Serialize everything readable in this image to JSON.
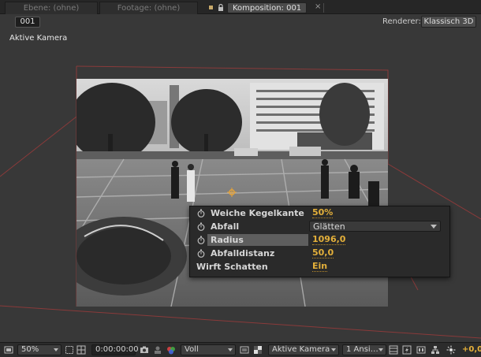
{
  "tabs": {
    "layer": "Ebene: (ohne)",
    "footage": "Footage: (ohne)",
    "composition": "Komposition: 001",
    "close": "×"
  },
  "toolbar": {
    "frame_label": "001",
    "renderer_label": "Renderer:",
    "renderer_value": "Klassisch 3D"
  },
  "viewport": {
    "camera_label": "Aktive Kamera"
  },
  "properties": [
    {
      "name": "Weiche Kegelkante",
      "value": "50%",
      "stopwatch": true
    },
    {
      "name": "Abfall",
      "value": "Glätten",
      "stopwatch": true,
      "dropdown": true
    },
    {
      "name": "Radius",
      "value": "1096,0",
      "stopwatch": true,
      "highlighted": true
    },
    {
      "name": "Abfalldistanz",
      "value": "50,0",
      "stopwatch": true
    },
    {
      "name": "Wirft Schatten",
      "value": "Ein",
      "stopwatch": false
    }
  ],
  "bottombar": {
    "zoom": "50%",
    "timecode": "0:00:00:00",
    "resolution": "Voll",
    "view": "Aktive Kamera",
    "views": "1 Ansi…",
    "exposure": "+0,0"
  },
  "colors": {
    "accent_value": "#e4b03a",
    "camera_frame": "#8a3a3a",
    "swatch": "#c7a96b"
  }
}
